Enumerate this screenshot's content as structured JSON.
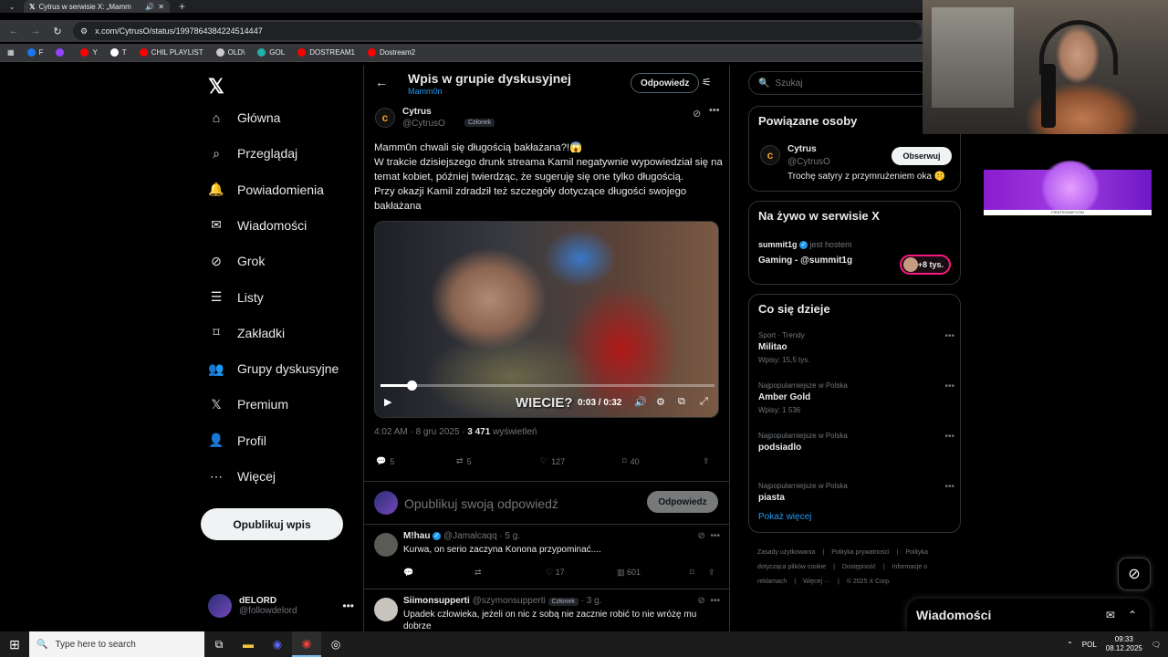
{
  "browser": {
    "tab_title": "Cytrus w serwisie X: „Mamm",
    "url": "x.com/CytrusO/status/1997864384224514447",
    "bookmarks": [
      {
        "label": "F",
        "color": "#1877f2"
      },
      {
        "label": "",
        "color": "#9146ff"
      },
      {
        "label": "Y",
        "color": "#ff0000"
      },
      {
        "label": "T",
        "color": "#ffffff"
      },
      {
        "label": "CHIL PLAYLIST",
        "color": "#ff0000"
      },
      {
        "label": "OLD\\",
        "color": "#cccccc"
      },
      {
        "label": "GOL",
        "color": "#20b2aa"
      },
      {
        "label": "DOSTREAM1",
        "color": "#ff0000"
      },
      {
        "label": "Dostream2",
        "color": "#ff0000"
      }
    ]
  },
  "nav": {
    "items": [
      {
        "label": "Główna",
        "icon": "home-icon"
      },
      {
        "label": "Przeglądaj",
        "icon": "search-icon"
      },
      {
        "label": "Powiadomienia",
        "icon": "bell-icon"
      },
      {
        "label": "Wiadomości",
        "icon": "mail-icon"
      },
      {
        "label": "Grok",
        "icon": "grok-icon"
      },
      {
        "label": "Listy",
        "icon": "list-icon"
      },
      {
        "label": "Zakładki",
        "icon": "bookmark-icon"
      },
      {
        "label": "Grupy dyskusyjne",
        "icon": "people-icon"
      },
      {
        "label": "Premium",
        "icon": "x-icon"
      },
      {
        "label": "Profil",
        "icon": "user-icon"
      },
      {
        "label": "Więcej",
        "icon": "more-circle-icon"
      }
    ],
    "post_button": "Opublikuj wpis",
    "user": {
      "name": "dELORD",
      "handle": "@followdelord"
    }
  },
  "header": {
    "title": "Wpis w grupie dyskusyjnej",
    "subtitle": "Mamm0n",
    "reply_button": "Odpowiedz"
  },
  "post": {
    "author": "Cytrus",
    "handle": "@CytrusO",
    "badge": "Członek",
    "text": [
      "Mamm0n chwali się długością bakłażana?!😱",
      "W trakcie dzisiejszego drunk streama Kamil negatywnie wypowiedział się na temat kobiet, później twierdząc, że sugeruję się one tylko długością.",
      "Przy okazji Kamil zdradził też szczegóły dotyczące długości swojego bakłażana"
    ],
    "video": {
      "caption": "WIECIE?",
      "time": "0:03 / 0:32",
      "progress": 0.094
    },
    "timestamp": "4:02 AM · 8 gru 2025 · ",
    "views_count": "3 471",
    "views_label": " wyświetleń",
    "stats": {
      "replies": "5",
      "reposts": "5",
      "likes": "127",
      "bookmarks": "40"
    }
  },
  "reply_composer": {
    "placeholder": "Opublikuj swoją odpowiedź",
    "button": "Odpowiedz"
  },
  "comments": [
    {
      "name": "M!hau",
      "verified": true,
      "handle": "@Jamalcaqq",
      "time": "· 5 g.",
      "text": "Kurwa, on serio zaczyna Konona przypominać....",
      "replies": "",
      "reposts": "",
      "likes": "17",
      "views": "601"
    },
    {
      "name": "Siimonsupperti",
      "verified": false,
      "handle": "@szymonsupperti",
      "badge": "Członek",
      "time": "· 3 g.",
      "text": "Upadek człowieka, jeżeli on nic z sobą nie zacznie robić to nie wróżę mu dobrze"
    }
  ],
  "sidebar": {
    "search_placeholder": "Szukaj",
    "related": {
      "title": "Powiązane osoby",
      "name": "Cytrus",
      "handle": "@CytrusO",
      "bio": "Trochę satyry z przymrużeniem oka 🤫",
      "follow": "Obserwuj"
    },
    "live": {
      "title": "Na żywo w serwisie X",
      "host": "summit1g",
      "host_suffix": "jest hostem",
      "stream_title": "Gaming - @summit1g",
      "listeners": "+8 tys."
    },
    "trends": {
      "title": "Co się dzieje",
      "items": [
        {
          "context": "Sport · Trendy",
          "name": "Militao",
          "count": "Wpisy: 15,5 tys."
        },
        {
          "context": "Najpopularniejsze w Polska",
          "name": "Amber Gold",
          "count": "Wpisy: 1 536"
        },
        {
          "context": "Najpopularniejsze w Polska",
          "name": "podsiadlo",
          "count": ""
        },
        {
          "context": "Najpopularniejsze w Polska",
          "name": "piasta",
          "count": ""
        }
      ],
      "show_more": "Pokaż więcej"
    },
    "footer": [
      "Zasady użytkowania",
      "Polityka prywatności",
      "Polityka dotycząca plików cookie",
      "Dostępność",
      "Informacje o reklamach",
      "Więcej ···",
      "© 2025 X Corp."
    ]
  },
  "ad": {
    "domain": "PIRATESWAP.COM"
  },
  "messages_drawer": {
    "title": "Wiadomości"
  },
  "taskbar": {
    "search_placeholder": "Type here to search",
    "lang": "POL",
    "time": "09:33",
    "date": "08.12.2025"
  }
}
